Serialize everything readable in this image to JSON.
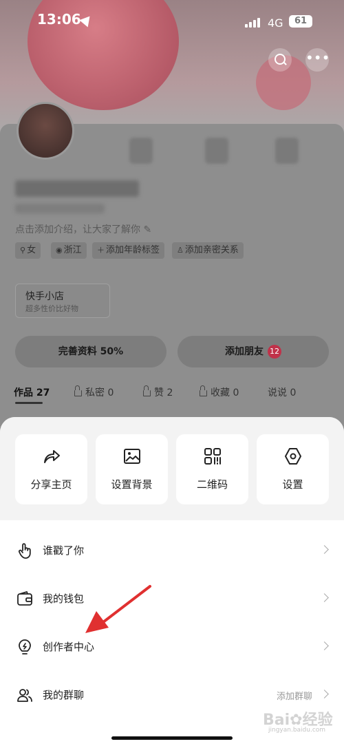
{
  "status_bar": {
    "time": "13:06",
    "network": "4G",
    "battery": "61"
  },
  "profile": {
    "intro": "点击添加介绍，让大家了解你 ✎",
    "tags": [
      {
        "icon": "gender-icon",
        "label": "女"
      },
      {
        "icon": "location-icon",
        "label": "浙江"
      },
      {
        "icon": "plus-icon",
        "label": "添加年龄标签"
      },
      {
        "icon": "person-icon",
        "label": "添加亲密关系"
      }
    ],
    "shop": {
      "title": "快手小店",
      "subtitle": "超多性价比好物"
    },
    "complete_button": "完善资料 50%",
    "add_friend_button": "添加朋友",
    "friend_badge": "12",
    "tabs": [
      "作品 27",
      "私密 0",
      "赞 2",
      "收藏 0",
      "说说 0"
    ]
  },
  "sheet": {
    "cards": [
      {
        "icon": "share-icon",
        "label": "分享主页"
      },
      {
        "icon": "image-icon",
        "label": "设置背景"
      },
      {
        "icon": "qrcode-icon",
        "label": "二维码"
      },
      {
        "icon": "settings-icon",
        "label": "设置"
      }
    ],
    "rows": [
      {
        "icon": "finger-tap-icon",
        "label": "谁戳了你",
        "hint": ""
      },
      {
        "icon": "wallet-icon",
        "label": "我的钱包",
        "hint": ""
      },
      {
        "icon": "lightbulb-icon",
        "label": "创作者中心",
        "hint": ""
      },
      {
        "icon": "group-icon",
        "label": "我的群聊",
        "hint": "添加群聊"
      }
    ]
  },
  "watermark": {
    "logo": "Bai✿经验",
    "sub": "jingyan.baidu.com"
  },
  "colors": {
    "sheet_bg": "#ffffff",
    "cards_area_bg": "#f3f3f3",
    "badge": "#c0324a",
    "arrow": "#e03030"
  }
}
